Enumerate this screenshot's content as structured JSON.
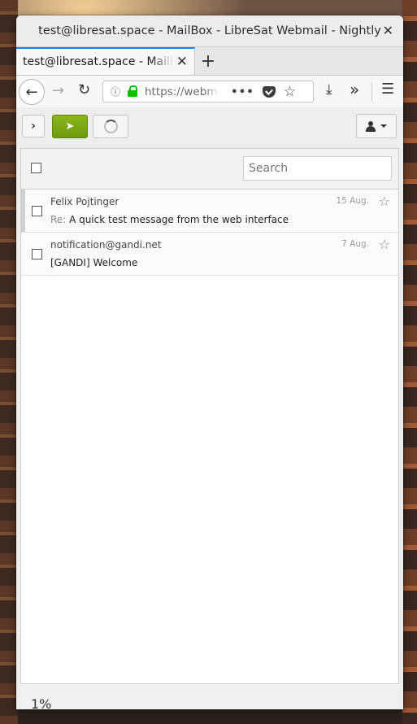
{
  "window": {
    "title": "test@libresat.space - MailBox - LibreSat Webmail - Nightly",
    "close_glyph": "✕"
  },
  "browser": {
    "tab_title": "test@libresat.space - MailBox - LibreSat Webmail",
    "tab_close_glyph": "✕",
    "new_tab_glyph": "+",
    "url": "https://webmail.libresat.space",
    "url_more_glyph": "•••"
  },
  "toolbar": {
    "expand_glyph": "›",
    "compose_glyph": "➤"
  },
  "list": {
    "search_placeholder": "Search",
    "messages": [
      {
        "from": "Felix Pojtinger",
        "subject_prefix": "Re:",
        "subject": "A quick test message from the web interface",
        "date": "15 Aug."
      },
      {
        "from": "notification@gandi.net",
        "subject_prefix": "",
        "subject": "[GANDI] Welcome",
        "date": "7 Aug."
      }
    ]
  },
  "footer": {
    "progress_text": "1%"
  }
}
